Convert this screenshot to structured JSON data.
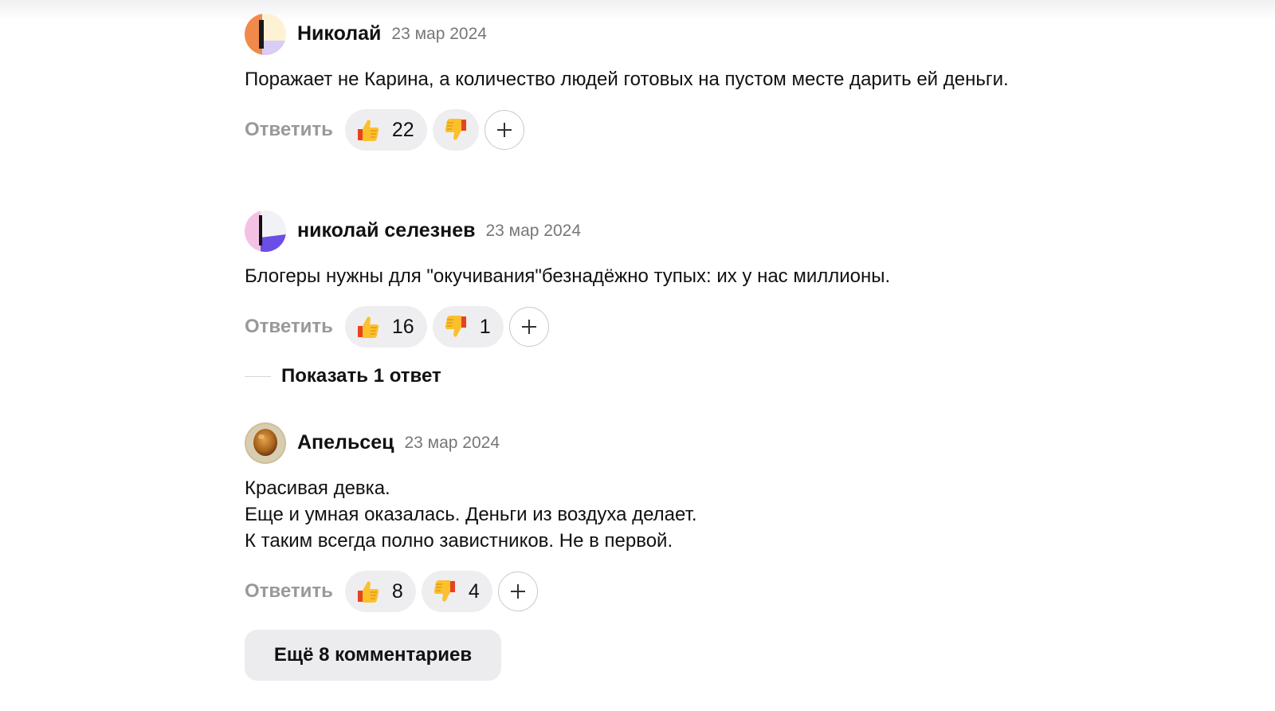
{
  "comments": [
    {
      "author": "Николай",
      "date": "23 мар 2024",
      "text": "Поражает не Карина, а количество людей готовых на пустом месте дарить ей деньги.",
      "reply_label": "Ответить",
      "likes": "22",
      "dislikes": "",
      "avatar": "orange-cream-lavender-avatar"
    },
    {
      "author": "николай селезнев",
      "date": "23 мар 2024",
      "text": "Блогеры нужны для \"окучивания\"безнадёжно тупых: их у нас миллионы.",
      "reply_label": "Ответить",
      "likes": "16",
      "dislikes": "1",
      "avatar": "pink-white-violet-avatar"
    },
    {
      "author": "Апельсец",
      "date": "23 мар 2024",
      "text": "Красивая девка.\nЕще и умная оказалась. Деньги из воздуха делает.\nК таким всегда полно завистников. Не в первой.",
      "reply_label": "Ответить",
      "likes": "8",
      "dislikes": "4",
      "avatar": "egg-photo-avatar"
    }
  ],
  "show_replies_label": "Показать 1 ответ",
  "more_comments_label": "Ещё 8 комментариев",
  "icons": {
    "like": "thumbs-up-icon",
    "dislike": "thumbs-down-icon",
    "add": "plus-icon"
  },
  "colors": {
    "reaction_bg": "#eeeef1",
    "secondary_text": "#999999",
    "date_text": "#777777",
    "more_button_bg": "#ececef"
  }
}
